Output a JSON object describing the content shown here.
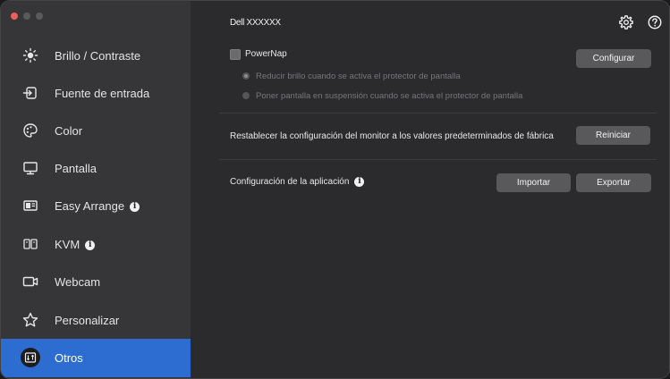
{
  "window": {
    "title": "Dell XXXXXX"
  },
  "sidebar": {
    "items": [
      {
        "label": "Brillo / Contraste",
        "icon": "brightness-icon"
      },
      {
        "label": "Fuente de entrada",
        "icon": "input-source-icon"
      },
      {
        "label": "Color",
        "icon": "color-palette-icon"
      },
      {
        "label": "Pantalla",
        "icon": "display-icon"
      },
      {
        "label": "Easy Arrange",
        "icon": "easy-arrange-icon",
        "info": true
      },
      {
        "label": "KVM",
        "icon": "kvm-icon",
        "info": true
      },
      {
        "label": "Webcam",
        "icon": "webcam-icon"
      },
      {
        "label": "Personalizar",
        "icon": "star-icon"
      },
      {
        "label": "Otros",
        "icon": "others-icon",
        "active": true
      }
    ]
  },
  "main": {
    "powernap": {
      "label": "PowerNap",
      "checked": false,
      "configure_label": "Configurar",
      "options": [
        {
          "label": "Reducir brillo cuando se activa el protector de pantalla",
          "selected": true
        },
        {
          "label": "Poner pantalla en suspensión cuando se activa el protector de pantalla",
          "selected": false
        }
      ]
    },
    "reset": {
      "label": "Restablecer la configuración del monitor a los valores predeterminados de fábrica",
      "button_label": "Reiniciar"
    },
    "app_config": {
      "label": "Configuración de la aplicación",
      "import_label": "Importar",
      "export_label": "Exportar"
    }
  },
  "colors": {
    "accent": "#2d6cd0",
    "sidebar_bg": "#363638",
    "main_bg": "#2b2b2e"
  }
}
